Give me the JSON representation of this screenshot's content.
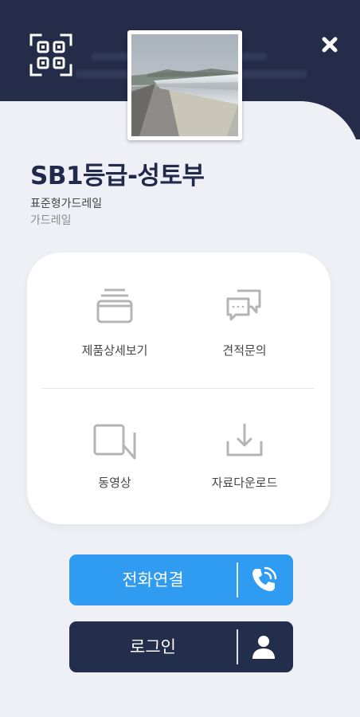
{
  "colors": {
    "header_bg": "#242c4a",
    "page_bg": "#eff0f5",
    "title": "#222a4b",
    "call_button": "#2f9bf1",
    "login_button": "#232d4c"
  },
  "header": {
    "qr_icon": "qr-code-icon",
    "close_icon": "close-icon"
  },
  "product": {
    "image": "guardrail-photo",
    "title": "SB1등급-성토부",
    "subtitle": "표준형가드레일",
    "category": "가드레일"
  },
  "menu": {
    "items": [
      {
        "label": "제품상세보기",
        "icon": "folder-stack-icon"
      },
      {
        "label": "견적문의",
        "icon": "chat-bubbles-icon"
      },
      {
        "label": "동영상",
        "icon": "video-camera-icon"
      },
      {
        "label": "자료다운로드",
        "icon": "download-tray-icon"
      }
    ]
  },
  "buttons": {
    "call": {
      "label": "전화연결",
      "icon": "phone-icon"
    },
    "login": {
      "label": "로그인",
      "icon": "user-icon"
    }
  }
}
